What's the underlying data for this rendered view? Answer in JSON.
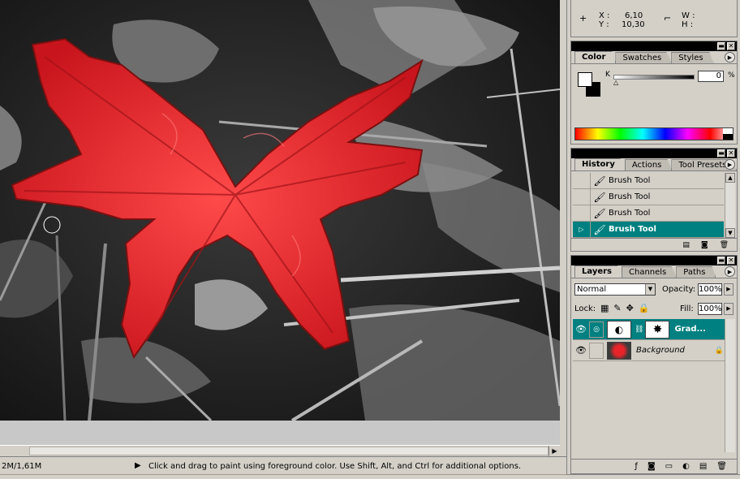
{
  "info": {
    "x_label": "X :",
    "x_value": "6,10",
    "y_label": "Y :",
    "y_value": "10,30",
    "w_label": "W :",
    "h_label": "H :"
  },
  "color_panel": {
    "tabs": [
      "Color",
      "Swatches",
      "Styles"
    ],
    "channel_label": "K",
    "channel_value": "0",
    "percent": "%",
    "foreground_color": "#ffffff",
    "background_color": "#000000"
  },
  "history_panel": {
    "tabs": [
      "History",
      "Actions",
      "Tool Presets"
    ],
    "items": [
      {
        "label": "Brush Tool",
        "icon": "brush-icon"
      },
      {
        "label": "Brush Tool",
        "icon": "brush-icon"
      },
      {
        "label": "Brush Tool",
        "icon": "brush-icon"
      },
      {
        "label": "Brush Tool",
        "icon": "brush-icon",
        "selected": true
      }
    ]
  },
  "layers_panel": {
    "tabs": [
      "Layers",
      "Channels",
      "Paths"
    ],
    "blend_mode": "Normal",
    "opacity_label": "Opacity:",
    "opacity_value": "100%",
    "lock_label": "Lock:",
    "fill_label": "Fill:",
    "fill_value": "100%",
    "layers": [
      {
        "name": "Grad...",
        "selected": true
      },
      {
        "name": "Background",
        "selected": false
      }
    ]
  },
  "status": {
    "doc_size": "2M/1,61M",
    "message": "Click and drag to paint using foreground color.  Use Shift, Alt, and Ctrl for additional options."
  },
  "colors": {
    "accent_selected": "#008080",
    "leaf_red": "#e8242a",
    "panel_bg": "#d4d0c8"
  }
}
